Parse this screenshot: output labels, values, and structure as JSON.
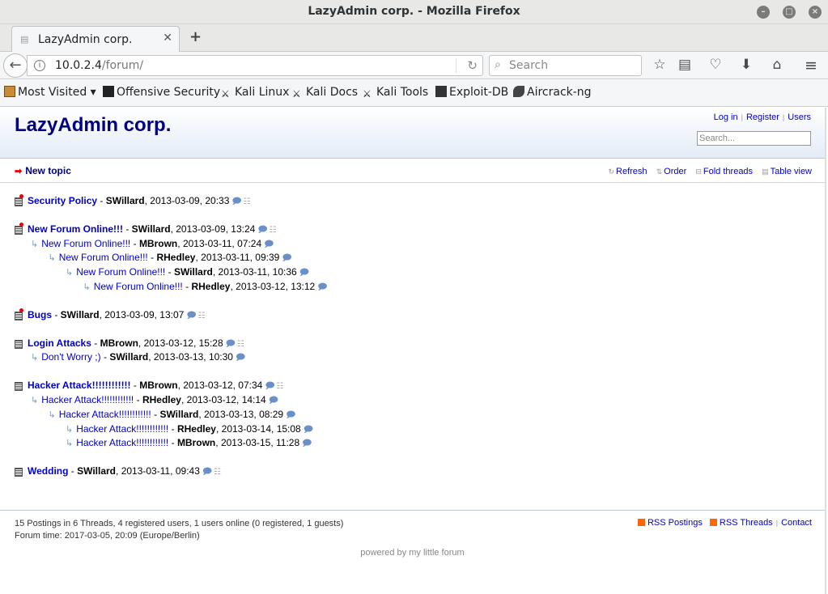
{
  "window": {
    "title": "LazyAdmin corp. - Mozilla Firefox"
  },
  "tab": {
    "title": "LazyAdmin corp."
  },
  "navbar": {
    "url_host": "10.0.2.4",
    "url_path": "/forum/",
    "search_placeholder": "Search"
  },
  "bookmarks": [
    {
      "label": "Most Visited ▾",
      "icon": "folder-icon"
    },
    {
      "label": "Offensive Security",
      "icon": "offsec-icon"
    },
    {
      "label": "Kali Linux",
      "icon": "kali-icon"
    },
    {
      "label": "Kali Docs",
      "icon": "kali-icon"
    },
    {
      "label": "Kali Tools",
      "icon": "kali-icon"
    },
    {
      "label": "Exploit-DB",
      "icon": "exploitdb-icon"
    },
    {
      "label": "Aircrack-ng",
      "icon": "aircrack-icon"
    }
  ],
  "forum": {
    "title": "LazyAdmin corp.",
    "user_menu": {
      "login": "Log in",
      "register": "Register",
      "users": "Users"
    },
    "search_placeholder": "Search...",
    "new_topic": "New topic",
    "subnav": {
      "refresh": "Refresh",
      "order": "Order",
      "fold": "Fold threads",
      "table": "Table view"
    }
  },
  "threads": [
    {
      "posts": [
        {
          "level": 0,
          "subject": "Security Policy",
          "author": "SWillard",
          "date": "2013-03-09, 20:33",
          "new": true
        }
      ]
    },
    {
      "posts": [
        {
          "level": 0,
          "subject": "New Forum Online!!!",
          "author": "SWillard",
          "date": "2013-03-09, 13:24",
          "new": true
        },
        {
          "level": 1,
          "subject": "New Forum Online!!!",
          "author": "MBrown",
          "date": "2013-03-11, 07:24"
        },
        {
          "level": 2,
          "subject": "New Forum Online!!!",
          "author": "RHedley",
          "date": "2013-03-11, 09:39"
        },
        {
          "level": 3,
          "subject": "New Forum Online!!!",
          "author": "SWillard",
          "date": "2013-03-11, 10:36"
        },
        {
          "level": 4,
          "subject": "New Forum Online!!!",
          "author": "RHedley",
          "date": "2013-03-12, 13:12"
        }
      ]
    },
    {
      "posts": [
        {
          "level": 0,
          "subject": "Bugs",
          "author": "SWillard",
          "date": "2013-03-09, 13:07",
          "new": true
        }
      ]
    },
    {
      "posts": [
        {
          "level": 0,
          "subject": "Login Attacks",
          "author": "MBrown",
          "date": "2013-03-12, 15:28"
        },
        {
          "level": 1,
          "subject": "Don't Worry ;)",
          "author": "SWillard",
          "date": "2013-03-13, 10:30"
        }
      ]
    },
    {
      "posts": [
        {
          "level": 0,
          "subject": "Hacker Attack!!!!!!!!!!!!",
          "author": "MBrown",
          "date": "2013-03-12, 07:34"
        },
        {
          "level": 1,
          "subject": "Hacker Attack!!!!!!!!!!!!",
          "author": "RHedley",
          "date": "2013-03-12, 14:14"
        },
        {
          "level": 2,
          "subject": "Hacker Attack!!!!!!!!!!!!",
          "author": "SWillard",
          "date": "2013-03-13, 08:29"
        },
        {
          "level": 3,
          "subject": "Hacker Attack!!!!!!!!!!!!",
          "author": "RHedley",
          "date": "2013-03-14, 15:08"
        },
        {
          "level": 3,
          "subject": "Hacker Attack!!!!!!!!!!!!",
          "author": "MBrown",
          "date": "2013-03-15, 11:28"
        }
      ]
    },
    {
      "posts": [
        {
          "level": 0,
          "subject": "Wedding",
          "author": "SWillard",
          "date": "2013-03-11, 09:43"
        }
      ]
    }
  ],
  "footer": {
    "stats": "15 Postings in 6 Threads, 4 registered users, 1 users online (0 registered, 1 guests)",
    "forum_time": "Forum time: 2017-03-05, 20:09 (Europe/Berlin)",
    "rss_postings": "RSS Postings",
    "rss_threads": "RSS Threads",
    "contact": "Contact",
    "powered": "powered by my little forum"
  }
}
